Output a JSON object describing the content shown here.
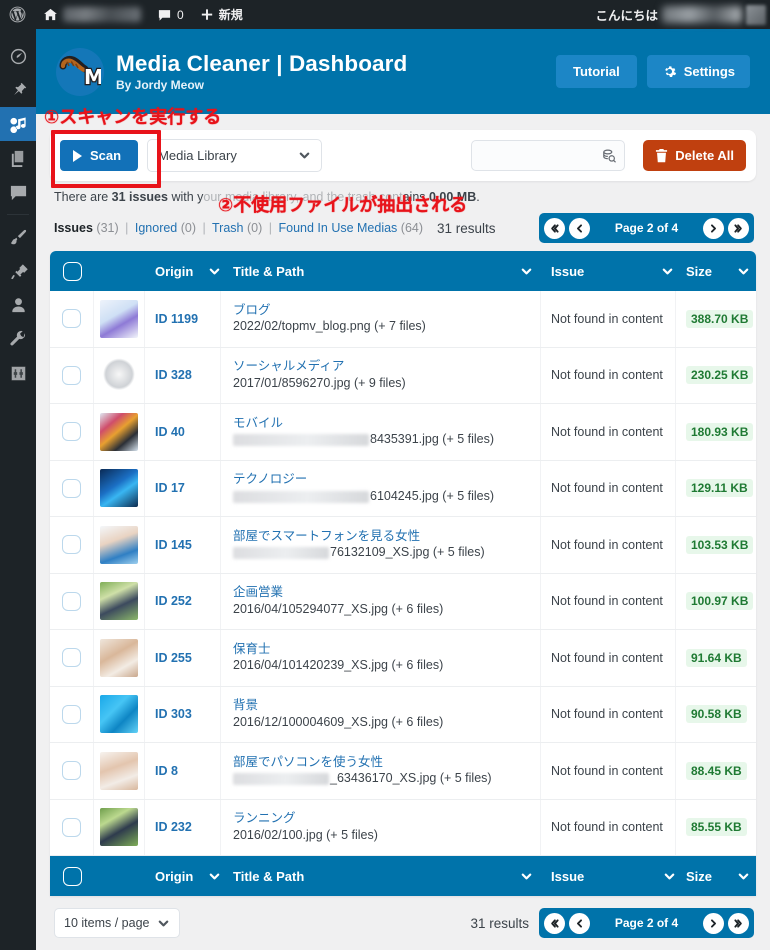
{
  "adminbar": {
    "wp_logo": "wordpress-logo-icon",
    "home_icon": "home-icon",
    "site_name_redacted": "",
    "comments_icon": "comment-icon",
    "comments_count": "0",
    "new_icon": "plus-icon",
    "new_label": "新規",
    "howdy": "こんにちは",
    "user_name_redacted": ""
  },
  "sidebar": {
    "items": [
      {
        "name": "dashboard",
        "icon": "dashboard-icon",
        "current": false
      },
      {
        "name": "posts",
        "icon": "pin-icon",
        "current": false
      },
      {
        "name": "media",
        "icon": "media-icon",
        "current": true
      },
      {
        "name": "pages",
        "icon": "pages-icon",
        "current": false
      },
      {
        "name": "comments",
        "icon": "comment-icon",
        "current": false
      },
      {
        "name": "appearance",
        "icon": "paintbrush-icon",
        "current": false
      },
      {
        "name": "plugins",
        "icon": "plug-icon",
        "current": false
      },
      {
        "name": "users",
        "icon": "user-icon",
        "current": false
      },
      {
        "name": "tools",
        "icon": "wrench-icon",
        "current": false
      },
      {
        "name": "settings",
        "icon": "settings-sliders-icon",
        "current": false
      }
    ]
  },
  "banner": {
    "logo_icon": "cat-tail-m-logo",
    "title": "Media Cleaner | Dashboard",
    "subtitle": "By Jordy Meow",
    "tutorial_label": "Tutorial",
    "settings_label": "Settings",
    "settings_icon": "gear-icon",
    "bg_color": "#0073aa"
  },
  "toolbar": {
    "scan_label": "Scan",
    "scan_icon": "play-icon",
    "source_selected": "Media Library",
    "source_chevron": "chevron-down-icon",
    "search_value": "",
    "search_placeholder": "",
    "search_icon": "media-search-icon",
    "delete_all_label": "Delete All",
    "delete_all_icon": "trash-icon",
    "delete_all_color": "#c0400f",
    "scan_color": "#1271b8"
  },
  "status": {
    "prefix": "There are ",
    "issues_bold": "31 issues",
    "middle": " with y",
    "obscured": "our media library, and the trash cont",
    "suffix_pre": "ains ",
    "size_bold": "0.00 MB",
    "suffix_end": "."
  },
  "tabs": {
    "items": [
      {
        "label": "Issues",
        "count": "(31)",
        "current": true
      },
      {
        "label": "Ignored",
        "count": "(0)",
        "current": false
      },
      {
        "label": "Trash",
        "count": "(0)",
        "current": false
      },
      {
        "label": "Found In Use Medias",
        "count": "(64)",
        "current": false
      }
    ],
    "separator": "|",
    "results_label": "31 results"
  },
  "pager": {
    "first_icon": "chevrons-left-icon",
    "prev_icon": "chevron-left-icon",
    "label": "Page 2 of 4",
    "next_icon": "chevron-right-icon",
    "last_icon": "chevrons-right-icon",
    "bg_color": "#0073aa"
  },
  "table": {
    "columns": {
      "origin": "Origin",
      "title_path": "Title & Path",
      "issue": "Issue",
      "size": "Size"
    },
    "sort_icon": "chevron-down-icon",
    "select_all_icon": "checkbox-unchecked",
    "rows": [
      {
        "id": "ID 1199",
        "title": "ブログ",
        "path": "2022/02/topmv_blog.png (+ 7 files)",
        "path_redacted_width": 0,
        "issue": "Not found in content",
        "size": "388.70 KB",
        "thumb": "blog-illustration"
      },
      {
        "id": "ID 328",
        "title": "ソーシャルメディア",
        "path": "2017/01/8596270.jpg (+ 9 files)",
        "path_redacted_width": 0,
        "issue": "Not found in content",
        "size": "230.25 KB",
        "thumb": "social-media-globe"
      },
      {
        "id": "ID 40",
        "title": "モバイル",
        "path": "8435391.jpg (+ 5 files)",
        "path_redacted_width": 136,
        "issue": "Not found in content",
        "size": "180.93 KB",
        "thumb": "mobile-phone-icons"
      },
      {
        "id": "ID 17",
        "title": "テクノロジー",
        "path": "6104245.jpg (+ 5 files)",
        "path_redacted_width": 136,
        "issue": "Not found in content",
        "size": "129.11 KB",
        "thumb": "technology-man"
      },
      {
        "id": "ID 145",
        "title": "部屋でスマートフォンを見る女性",
        "path": "76132109_XS.jpg (+ 5 files)",
        "path_redacted_width": 96,
        "issue": "Not found in content",
        "size": "103.53 KB",
        "thumb": "woman-smartphone"
      },
      {
        "id": "ID 252",
        "title": "企画営業",
        "path": "2016/04/105294077_XS.jpg (+ 6 files)",
        "path_redacted_width": 0,
        "issue": "Not found in content",
        "size": "100.97 KB",
        "thumb": "business-woman-outdoor"
      },
      {
        "id": "ID 255",
        "title": "保育士",
        "path": "2016/04/101420239_XS.jpg (+ 6 files)",
        "path_redacted_width": 0,
        "issue": "Not found in content",
        "size": "91.64 KB",
        "thumb": "nursery-baby"
      },
      {
        "id": "ID 303",
        "title": "背景",
        "path": "2016/12/100004609_XS.jpg (+ 6 files)",
        "path_redacted_width": 0,
        "issue": "Not found in content",
        "size": "90.58 KB",
        "thumb": "blue-abstract-background"
      },
      {
        "id": "ID 8",
        "title": "部屋でパソコンを使う女性",
        "path": "_63436170_XS.jpg (+ 5 files)",
        "path_redacted_width": 96,
        "issue": "Not found in content",
        "size": "88.45 KB",
        "thumb": "woman-laptop"
      },
      {
        "id": "ID 232",
        "title": "ランニング",
        "path": "2016/02/100.jpg (+ 5 files)",
        "path_redacted_width": 0,
        "issue": "Not found in content",
        "size": "85.55 KB",
        "thumb": "running-women-park"
      }
    ]
  },
  "bottombar": {
    "per_page_label": "10 items / page",
    "per_page_chevron": "chevron-down-icon",
    "results_label": "31 results",
    "pager_label": "Page 2 of 4"
  },
  "annotations": {
    "one": "①スキャンを実行する",
    "two": "②不使用ファイルが抽出される",
    "color": "#e8131a"
  }
}
